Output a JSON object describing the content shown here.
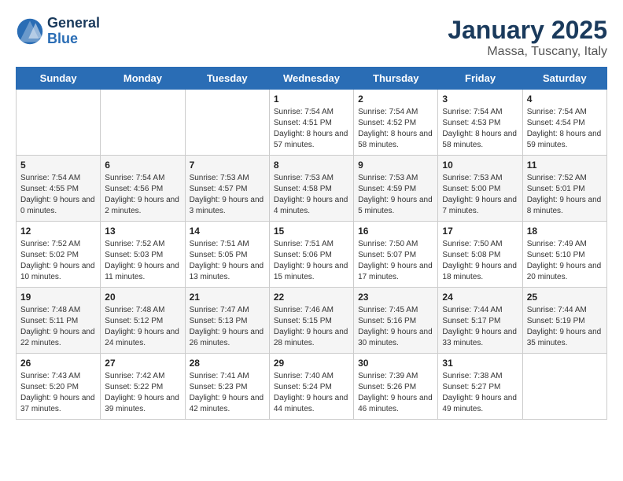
{
  "header": {
    "logo_line1": "General",
    "logo_line2": "Blue",
    "title": "January 2025",
    "subtitle": "Massa, Tuscany, Italy"
  },
  "days_of_week": [
    "Sunday",
    "Monday",
    "Tuesday",
    "Wednesday",
    "Thursday",
    "Friday",
    "Saturday"
  ],
  "weeks": [
    [
      {
        "day": "",
        "text": ""
      },
      {
        "day": "",
        "text": ""
      },
      {
        "day": "",
        "text": ""
      },
      {
        "day": "1",
        "text": "Sunrise: 7:54 AM\nSunset: 4:51 PM\nDaylight: 8 hours and 57 minutes."
      },
      {
        "day": "2",
        "text": "Sunrise: 7:54 AM\nSunset: 4:52 PM\nDaylight: 8 hours and 58 minutes."
      },
      {
        "day": "3",
        "text": "Sunrise: 7:54 AM\nSunset: 4:53 PM\nDaylight: 8 hours and 58 minutes."
      },
      {
        "day": "4",
        "text": "Sunrise: 7:54 AM\nSunset: 4:54 PM\nDaylight: 8 hours and 59 minutes."
      }
    ],
    [
      {
        "day": "5",
        "text": "Sunrise: 7:54 AM\nSunset: 4:55 PM\nDaylight: 9 hours and 0 minutes."
      },
      {
        "day": "6",
        "text": "Sunrise: 7:54 AM\nSunset: 4:56 PM\nDaylight: 9 hours and 2 minutes."
      },
      {
        "day": "7",
        "text": "Sunrise: 7:53 AM\nSunset: 4:57 PM\nDaylight: 9 hours and 3 minutes."
      },
      {
        "day": "8",
        "text": "Sunrise: 7:53 AM\nSunset: 4:58 PM\nDaylight: 9 hours and 4 minutes."
      },
      {
        "day": "9",
        "text": "Sunrise: 7:53 AM\nSunset: 4:59 PM\nDaylight: 9 hours and 5 minutes."
      },
      {
        "day": "10",
        "text": "Sunrise: 7:53 AM\nSunset: 5:00 PM\nDaylight: 9 hours and 7 minutes."
      },
      {
        "day": "11",
        "text": "Sunrise: 7:52 AM\nSunset: 5:01 PM\nDaylight: 9 hours and 8 minutes."
      }
    ],
    [
      {
        "day": "12",
        "text": "Sunrise: 7:52 AM\nSunset: 5:02 PM\nDaylight: 9 hours and 10 minutes."
      },
      {
        "day": "13",
        "text": "Sunrise: 7:52 AM\nSunset: 5:03 PM\nDaylight: 9 hours and 11 minutes."
      },
      {
        "day": "14",
        "text": "Sunrise: 7:51 AM\nSunset: 5:05 PM\nDaylight: 9 hours and 13 minutes."
      },
      {
        "day": "15",
        "text": "Sunrise: 7:51 AM\nSunset: 5:06 PM\nDaylight: 9 hours and 15 minutes."
      },
      {
        "day": "16",
        "text": "Sunrise: 7:50 AM\nSunset: 5:07 PM\nDaylight: 9 hours and 17 minutes."
      },
      {
        "day": "17",
        "text": "Sunrise: 7:50 AM\nSunset: 5:08 PM\nDaylight: 9 hours and 18 minutes."
      },
      {
        "day": "18",
        "text": "Sunrise: 7:49 AM\nSunset: 5:10 PM\nDaylight: 9 hours and 20 minutes."
      }
    ],
    [
      {
        "day": "19",
        "text": "Sunrise: 7:48 AM\nSunset: 5:11 PM\nDaylight: 9 hours and 22 minutes."
      },
      {
        "day": "20",
        "text": "Sunrise: 7:48 AM\nSunset: 5:12 PM\nDaylight: 9 hours and 24 minutes."
      },
      {
        "day": "21",
        "text": "Sunrise: 7:47 AM\nSunset: 5:13 PM\nDaylight: 9 hours and 26 minutes."
      },
      {
        "day": "22",
        "text": "Sunrise: 7:46 AM\nSunset: 5:15 PM\nDaylight: 9 hours and 28 minutes."
      },
      {
        "day": "23",
        "text": "Sunrise: 7:45 AM\nSunset: 5:16 PM\nDaylight: 9 hours and 30 minutes."
      },
      {
        "day": "24",
        "text": "Sunrise: 7:44 AM\nSunset: 5:17 PM\nDaylight: 9 hours and 33 minutes."
      },
      {
        "day": "25",
        "text": "Sunrise: 7:44 AM\nSunset: 5:19 PM\nDaylight: 9 hours and 35 minutes."
      }
    ],
    [
      {
        "day": "26",
        "text": "Sunrise: 7:43 AM\nSunset: 5:20 PM\nDaylight: 9 hours and 37 minutes."
      },
      {
        "day": "27",
        "text": "Sunrise: 7:42 AM\nSunset: 5:22 PM\nDaylight: 9 hours and 39 minutes."
      },
      {
        "day": "28",
        "text": "Sunrise: 7:41 AM\nSunset: 5:23 PM\nDaylight: 9 hours and 42 minutes."
      },
      {
        "day": "29",
        "text": "Sunrise: 7:40 AM\nSunset: 5:24 PM\nDaylight: 9 hours and 44 minutes."
      },
      {
        "day": "30",
        "text": "Sunrise: 7:39 AM\nSunset: 5:26 PM\nDaylight: 9 hours and 46 minutes."
      },
      {
        "day": "31",
        "text": "Sunrise: 7:38 AM\nSunset: 5:27 PM\nDaylight: 9 hours and 49 minutes."
      },
      {
        "day": "",
        "text": ""
      }
    ]
  ]
}
